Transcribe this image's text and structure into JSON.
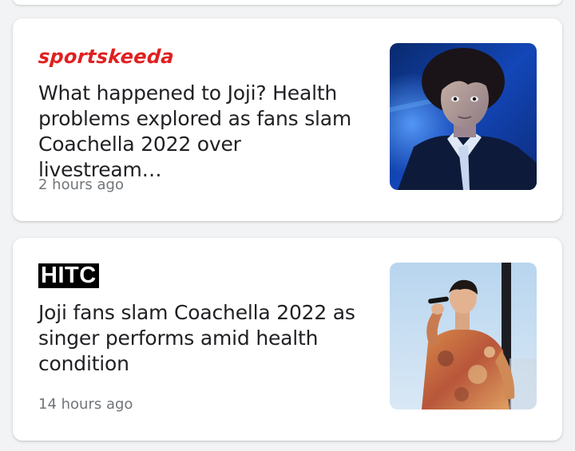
{
  "articles": [
    {
      "source": "sportskeeda",
      "headline": "What happened to Joji? Health problems explored as fans slam Coachella 2022 over livestream…",
      "time": "2 hours ago",
      "image": "joji-portrait-image"
    },
    {
      "source": "HITC",
      "headline": "Joji fans slam Coachella 2022 as singer performs amid health condition",
      "time": "14 hours ago",
      "image": "joji-performing-image"
    }
  ],
  "colors": {
    "page_background": "#f1f3f4",
    "card_background": "#ffffff",
    "headline": "#202124",
    "timestamp": "#70757a",
    "sportskeeda_brand": "#e02020",
    "hitc_brand_bg": "#000000"
  }
}
